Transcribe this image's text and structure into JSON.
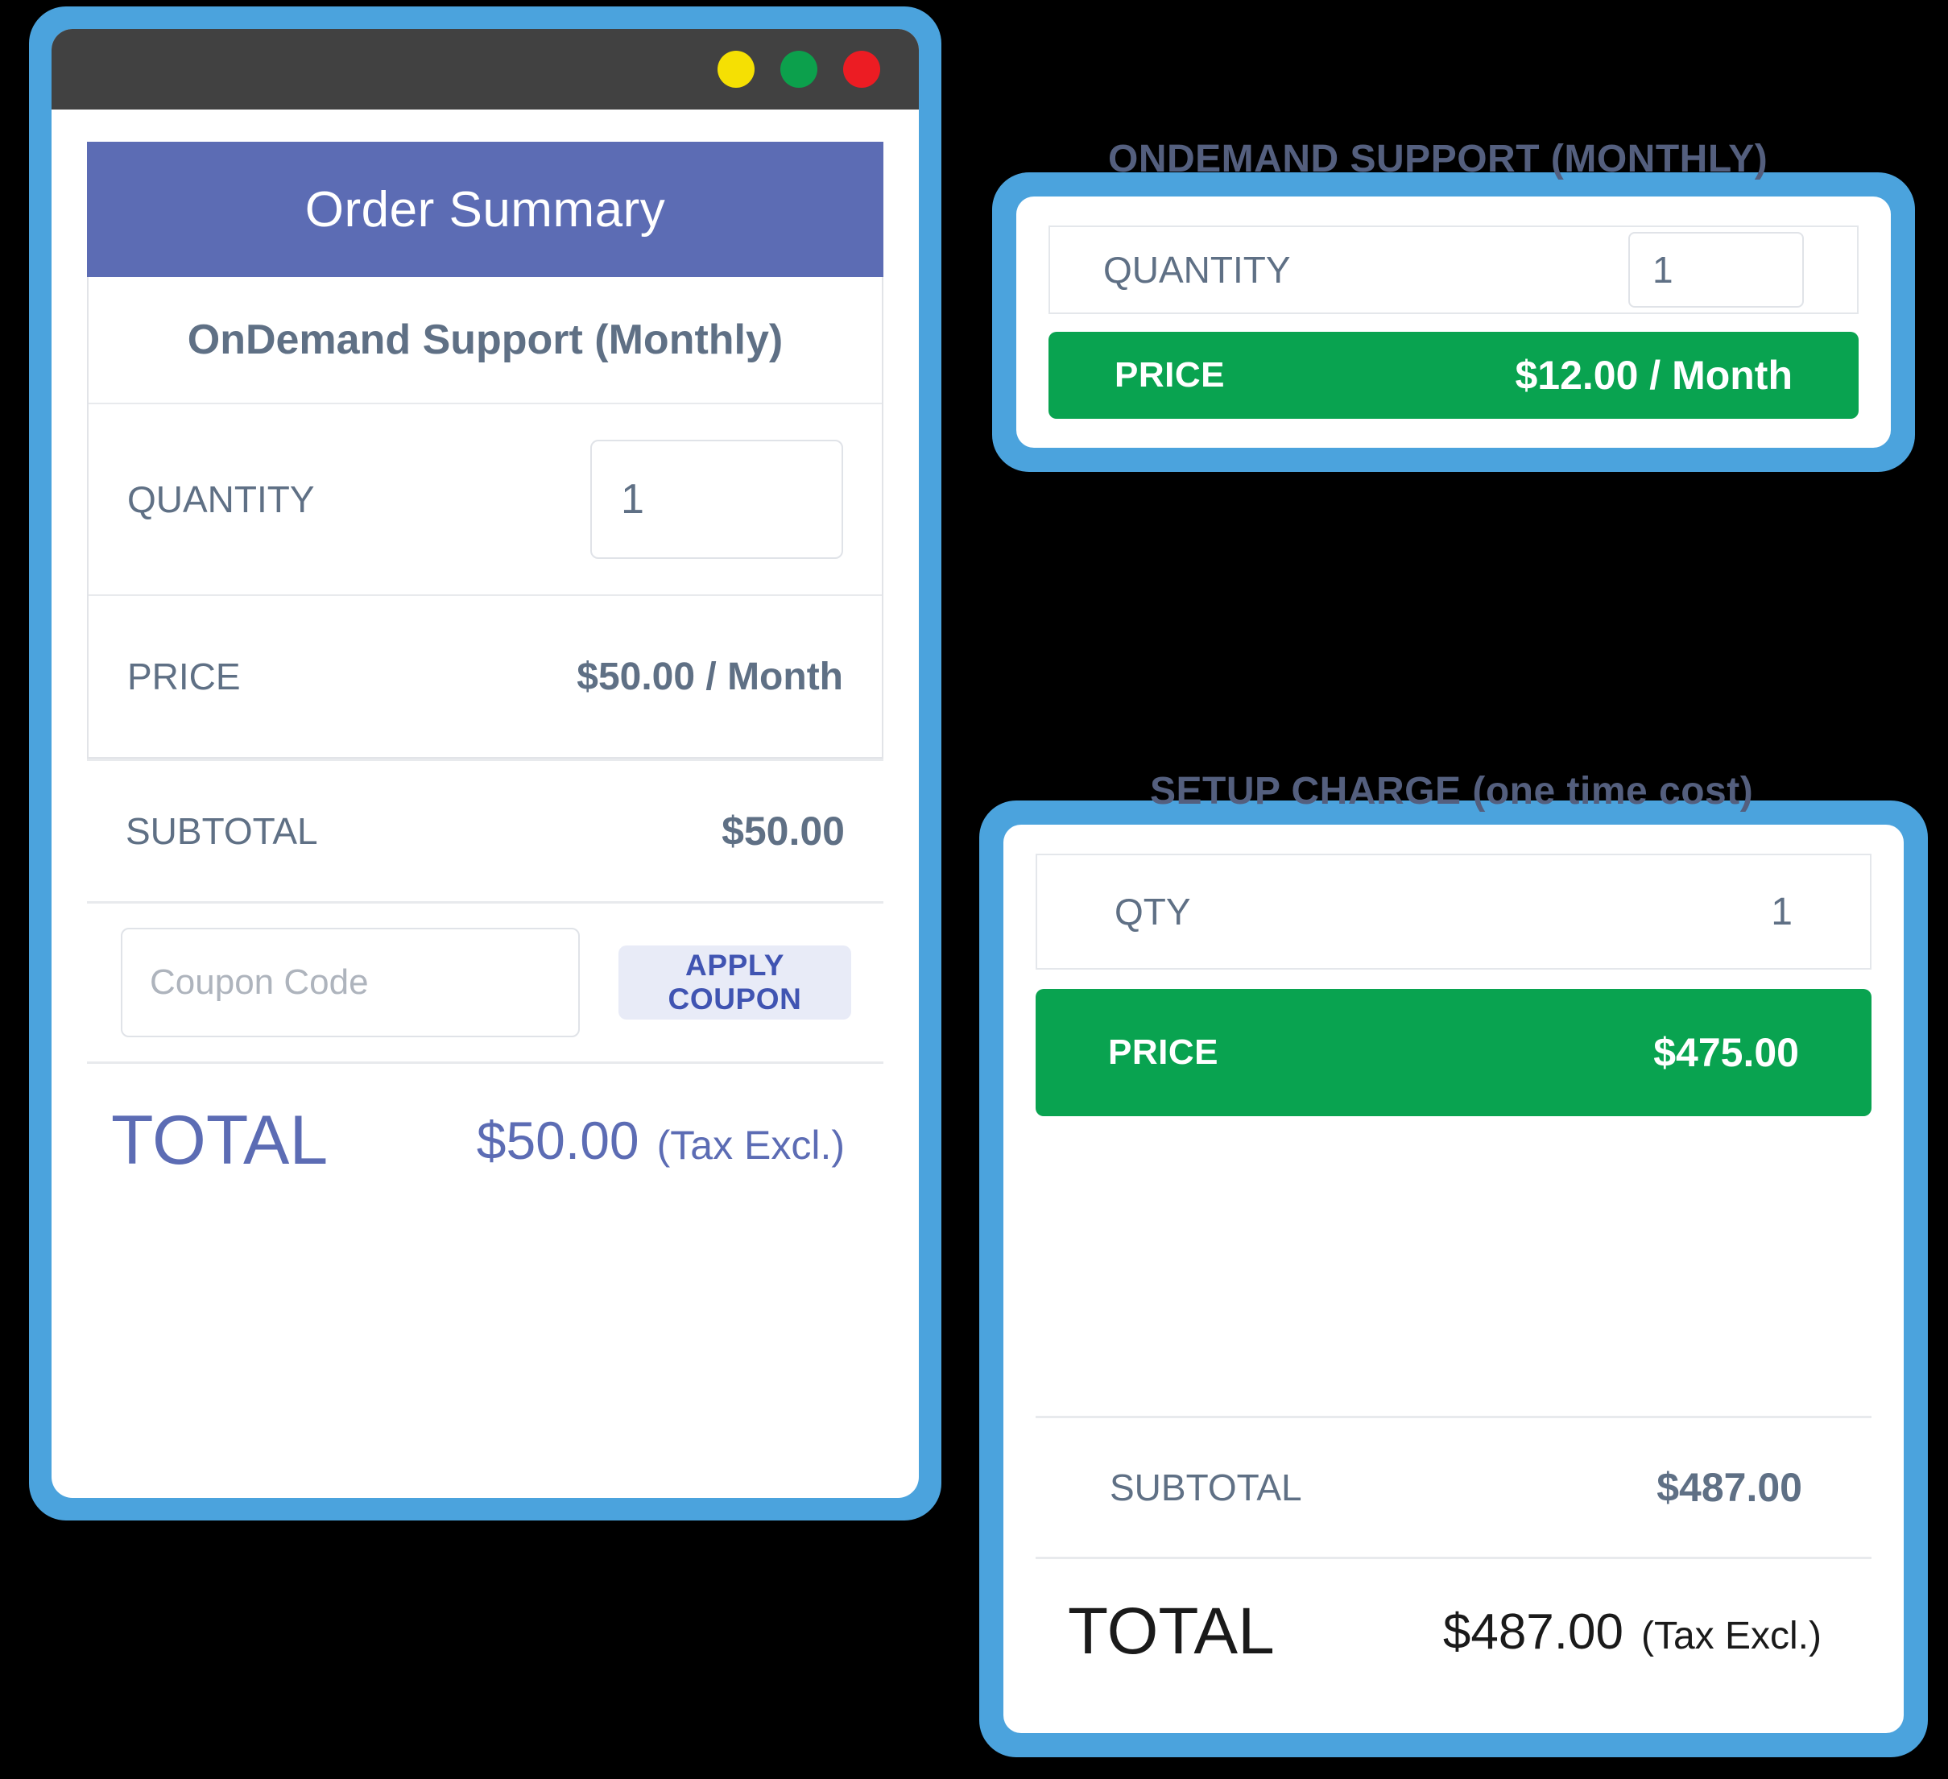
{
  "browser": {
    "window_controls": [
      {
        "name": "minimize-dot",
        "color": "#F5E003"
      },
      {
        "name": "maximize-dot",
        "color": "#0CA04C"
      },
      {
        "name": "close-dot",
        "color": "#EC1C23"
      }
    ]
  },
  "order_summary": {
    "header_title": "Order Summary",
    "header_color": "#5C6CB4",
    "product_name": "OnDemand Support (Monthly)",
    "quantity_label": "QUANTITY",
    "quantity_value": "1",
    "price_label": "PRICE",
    "price_value": "$50.00 / Month",
    "subtotal_label": "SUBTOTAL",
    "subtotal_value": "$50.00",
    "coupon_placeholder": "Coupon Code",
    "coupon_value": "",
    "apply_coupon_label": "APPLY COUPON",
    "total_label": "TOTAL",
    "total_value": "$50.00",
    "total_tax_note": "(Tax Excl.)"
  },
  "monthly_card": {
    "heading": "ONDEMAND SUPPORT (MONTHLY)",
    "quantity_label": "QUANTITY",
    "quantity_value": "1",
    "price_label": "PRICE",
    "price_value": "$12.00 / Month",
    "price_bar_color": "#09A350"
  },
  "setup_card": {
    "heading": "SETUP CHARGE (one time cost)",
    "qty_label": "QTY",
    "qty_value": "1",
    "price_label": "PRICE",
    "price_value": "$475.00",
    "price_bar_color": "#09A350",
    "subtotal_label": "SUBTOTAL",
    "subtotal_value": "$487.00",
    "total_label": "TOTAL",
    "total_value": "$487.00",
    "total_tax_note": "(Tax Excl.)"
  },
  "theme": {
    "frame_blue": "#4BA3DD",
    "titlebar_gray": "#414141",
    "slate_text": "#5F7085",
    "indigo": "#5C6CB4",
    "coupon_btn_bg": "#E8EBF7",
    "coupon_btn_text": "#4054B2"
  }
}
